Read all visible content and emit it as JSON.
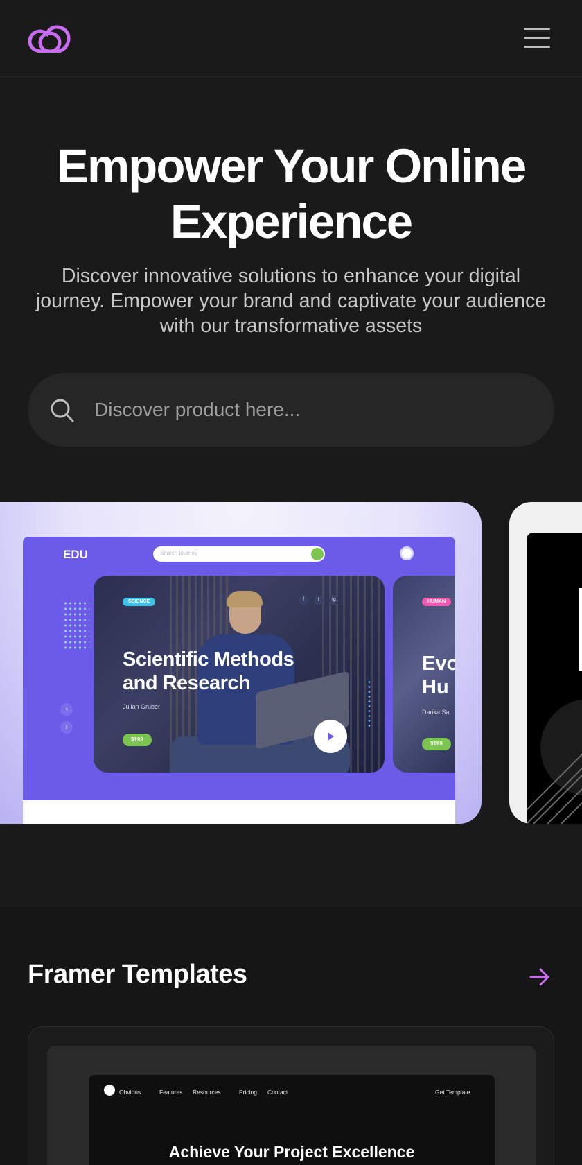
{
  "brand": {
    "accent": "#c86cf0"
  },
  "hero": {
    "title_line1": "Empower Your Online",
    "title_line2": "Experience",
    "subtitle": "Discover innovative solutions to enhance your digital journey. Empower your brand and captivate your audience with our transformative assets"
  },
  "search": {
    "placeholder": "Discover product here..."
  },
  "featured": {
    "card1": {
      "logo": "EDU",
      "search_placeholder": "Search journey",
      "course": {
        "badge": "SCIENCE",
        "title": "Scientific Methods and Research",
        "author": "Julian Gruber",
        "price": "$199"
      },
      "course2": {
        "badge": "HUMAN",
        "title_partial": "Evo Hu",
        "author_partial": "Darika Sa",
        "price": "$199"
      },
      "social_icons": [
        "f",
        "t",
        "ig"
      ]
    }
  },
  "templates": {
    "title": "Framer Templates",
    "card": {
      "brand": "Obvious",
      "nav": [
        "Features",
        "Resources",
        "Pricing",
        "Contact"
      ],
      "cta": "Get Template",
      "headline": "Achieve Your Project Excellence"
    }
  }
}
